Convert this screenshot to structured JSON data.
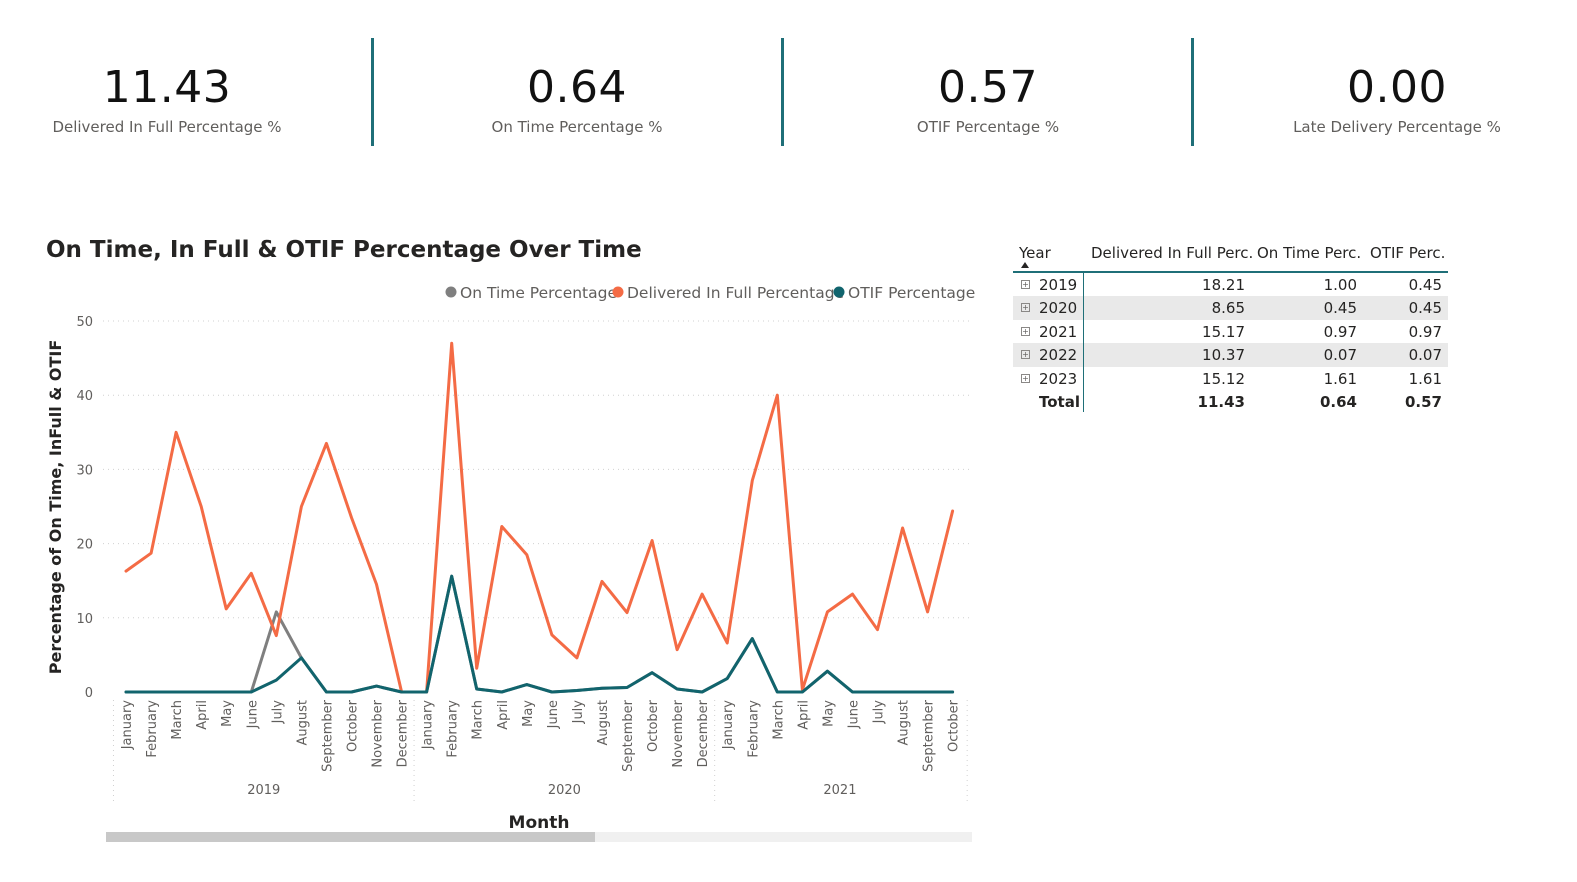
{
  "kpis": [
    {
      "value": "11.43",
      "label": "Delivered In Full Percentage %"
    },
    {
      "value": "0.64",
      "label": "On Time Percentage %"
    },
    {
      "value": "0.57",
      "label": "OTIF Percentage %"
    },
    {
      "value": "0.00",
      "label": "Late Delivery Percentage %"
    }
  ],
  "colors": {
    "accent": "#1f6f78",
    "on_time": "#7f7f7f",
    "in_full": "#f46b45",
    "otif": "#11646d"
  },
  "chart_data": {
    "type": "line",
    "title": "On Time, In Full & OTIF Percentage Over Time",
    "xlabel": "Month",
    "ylabel": "Percentage of On Time, InFull & OTIF",
    "ylim": [
      0,
      50
    ],
    "yticks": [
      0,
      10,
      20,
      30,
      40,
      50
    ],
    "grid": true,
    "legend_position": "top-right",
    "categories": [
      "January",
      "February",
      "March",
      "April",
      "May",
      "June",
      "July",
      "August",
      "September",
      "October",
      "November",
      "December",
      "January",
      "February",
      "March",
      "April",
      "May",
      "June",
      "July",
      "August",
      "September",
      "October",
      "November",
      "December",
      "January",
      "February",
      "March",
      "April",
      "May",
      "June",
      "July",
      "August",
      "September",
      "October"
    ],
    "year_groups": [
      {
        "label": "2019",
        "count": 12
      },
      {
        "label": "2020",
        "count": 12
      },
      {
        "label": "2021",
        "count": 10
      }
    ],
    "series": [
      {
        "name": "On Time Percentage",
        "color": "#7f7f7f",
        "values": [
          0,
          0,
          0,
          0,
          0,
          0,
          10.8,
          4.6,
          0,
          0,
          0.8,
          0,
          0,
          15.6,
          0.4,
          0,
          1,
          0,
          0.2,
          0.5,
          0.6,
          2.6,
          0.4,
          0,
          1.8,
          7.2,
          0,
          0,
          2.8,
          0,
          0,
          0,
          0,
          0
        ]
      },
      {
        "name": "Delivered In Full Percentage",
        "color": "#f46b45",
        "values": [
          16.3,
          18.7,
          35,
          25,
          11.2,
          16,
          7.6,
          25,
          33.5,
          23.5,
          14.5,
          0,
          0,
          47,
          3.2,
          22.3,
          18.5,
          7.7,
          4.6,
          14.9,
          10.7,
          20.4,
          5.7,
          13.2,
          6.6,
          28.5,
          40,
          0.3,
          10.8,
          13.2,
          8.4,
          22.1,
          10.8,
          24.4
        ]
      },
      {
        "name": "OTIF Percentage",
        "color": "#11646d",
        "values": [
          0,
          0,
          0,
          0,
          0,
          0,
          1.6,
          4.6,
          0,
          0,
          0.8,
          0,
          0,
          15.6,
          0.4,
          0,
          1,
          0,
          0.2,
          0.5,
          0.6,
          2.6,
          0.4,
          0,
          1.8,
          7.2,
          0,
          0,
          2.8,
          0,
          0,
          0,
          0,
          0
        ]
      }
    ]
  },
  "table": {
    "headers": [
      "Year",
      "Delivered In Full Perc.",
      "On Time Perc.",
      "OTIF Perc."
    ],
    "rows": [
      {
        "year": "2019",
        "dif": "18.21",
        "ot": "1.00",
        "otif": "0.45"
      },
      {
        "year": "2020",
        "dif": "8.65",
        "ot": "0.45",
        "otif": "0.45"
      },
      {
        "year": "2021",
        "dif": "15.17",
        "ot": "0.97",
        "otif": "0.97"
      },
      {
        "year": "2022",
        "dif": "10.37",
        "ot": "0.07",
        "otif": "0.07"
      },
      {
        "year": "2023",
        "dif": "15.12",
        "ot": "1.61",
        "otif": "1.61"
      }
    ],
    "total": {
      "label": "Total",
      "dif": "11.43",
      "ot": "0.64",
      "otif": "0.57"
    }
  }
}
